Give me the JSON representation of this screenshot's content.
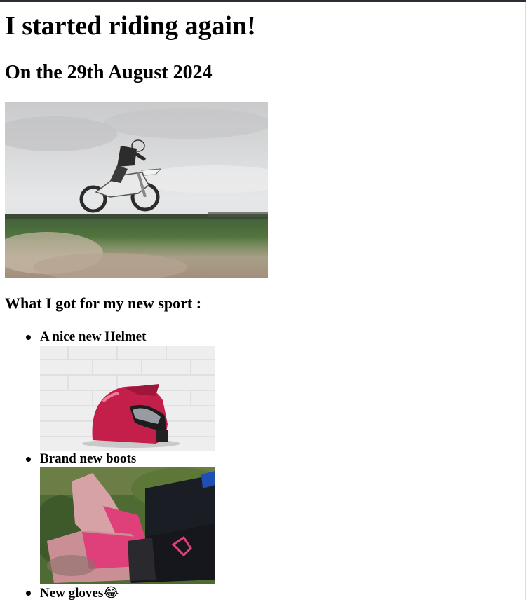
{
  "post": {
    "title": "I started riding again!",
    "date_heading": "On the 29th August 2024",
    "gear_heading": "What I got for my new sport :"
  },
  "gear": [
    {
      "label": "A nice new Helmet",
      "emoji": ""
    },
    {
      "label": "Brand new boots",
      "emoji": ""
    },
    {
      "label": "New gloves",
      "emoji": "😂"
    }
  ],
  "colors": {
    "helmet": "#c41e4a",
    "boots": "#e0407a",
    "page_background": "#ffffff",
    "top_bar": "#2b2f36"
  }
}
